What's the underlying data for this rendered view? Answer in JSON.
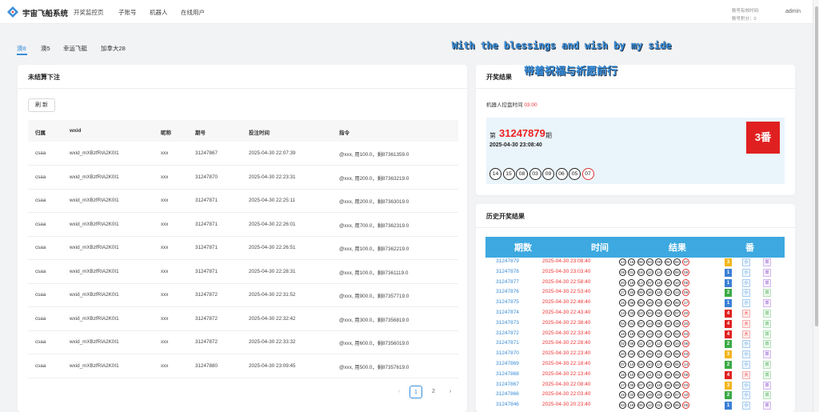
{
  "header": {
    "brand": "宇宙飞船系统",
    "nav": [
      "开奖监控页",
      "子账号",
      "机器人",
      "在线用户"
    ],
    "account_expiry_label": "账号有效时间:",
    "account_points_label": "账号积分：0",
    "user": "admin"
  },
  "tabs": [
    "澳8",
    "澳5",
    "幸运飞艇",
    "加拿大28"
  ],
  "banner": {
    "english": "With the blessings and wish by my side",
    "chinese": "带着祝福与祈愿前行"
  },
  "pending": {
    "title": "未结算下注",
    "refresh_label": "刷 新",
    "columns": [
      "归属",
      "wxid",
      "昵称",
      "期号",
      "投注时间",
      "指令"
    ],
    "rows": [
      [
        "csaa",
        "wxid_mXBzfRIA2K0I1",
        "xxx",
        "31247867",
        "2025-04-30 22:07:39",
        "@xxx, 用100.0，剩87361359.0"
      ],
      [
        "csaa",
        "wxid_mXBzfRIA2K0I1",
        "xxx",
        "31247870",
        "2025-04-30 22:23:31",
        "@xxx, 用200.0，剩87363219.0"
      ],
      [
        "csaa",
        "wxid_mXBzfRIA2K0I1",
        "xxx",
        "31247871",
        "2025-04-30 22:25:11",
        "@xxx, 用200.0，剩87363019.0"
      ],
      [
        "csaa",
        "wxid_mXBzfRIA2K0I1",
        "xxx",
        "31247871",
        "2025-04-30 22:26:01",
        "@xxx, 用700.0，剩87362319.0"
      ],
      [
        "csaa",
        "wxid_mXBzfRIA2K0I1",
        "xxx",
        "31247871",
        "2025-04-30 22:26:51",
        "@xxx, 用100.0，剩87362219.0"
      ],
      [
        "csaa",
        "wxid_mXBzfRIA2K0I1",
        "xxx",
        "31247871",
        "2025-04-30 22:28:31",
        "@xxx, 用100.0，剩87361119.0"
      ],
      [
        "csaa",
        "wxid_mXBzfRIA2K0I1",
        "xxx",
        "31247872",
        "2025-04-30 22:31:52",
        "@xxx, 用900.0，剩87357719.0"
      ],
      [
        "csaa",
        "wxid_mXBzfRIA2K0I1",
        "xxx",
        "31247872",
        "2025-04-30 22:32:42",
        "@xxx, 用300.0，剩87356819.0"
      ],
      [
        "csaa",
        "wxid_mXBzfRIA2K0I1",
        "xxx",
        "31247872",
        "2025-04-30 22:33:32",
        "@xxx, 用600.0，剩87356019.0"
      ],
      [
        "csaa",
        "wxid_mXBzfRIA2K0I1",
        "xxx",
        "31247880",
        "2025-04-30 23:09:45",
        "@xxx, 用500.0，剩87357619.0"
      ]
    ],
    "pages": [
      "1",
      "2"
    ]
  },
  "result": {
    "title": "开奖结果",
    "robot_label": "机器人控盘时间",
    "robot_time": "03:00",
    "issue_prefix": "第",
    "issue": "31247879",
    "issue_suffix": "期",
    "time": "2025-04-30 23:08:40",
    "fan": "3番",
    "balls": [
      "14",
      "15",
      "08",
      "03",
      "09",
      "06",
      "05",
      "07"
    ]
  },
  "history": {
    "title": "历史开奖结果",
    "columns": [
      "期数",
      "时间",
      "结果",
      "番"
    ],
    "rows": [
      {
        "issue": "31247879",
        "time": "2025-04-30 23:08:40",
        "balls": [
          "14",
          "15",
          "08",
          "03",
          "09",
          "06",
          "05",
          "07"
        ],
        "fan": "3",
        "size": "小",
        "parity": "单"
      },
      {
        "issue": "31247878",
        "time": "2025-04-30 23:03:40",
        "balls": [
          "09",
          "01",
          "18",
          "12",
          "14",
          "15",
          "08",
          "05"
        ],
        "fan": "1",
        "size": "小",
        "parity": "单"
      },
      {
        "issue": "31247877",
        "time": "2025-04-30 22:58:40",
        "balls": [
          "20",
          "19",
          "13",
          "07",
          "16",
          "08",
          "10",
          "05"
        ],
        "fan": "1",
        "size": "小",
        "parity": "单"
      },
      {
        "issue": "31247876",
        "time": "2025-04-30 22:53:40",
        "balls": [
          "17",
          "20",
          "09",
          "18",
          "16",
          "12",
          "13",
          "06"
        ],
        "fan": "2",
        "size": "小",
        "parity": "双"
      },
      {
        "issue": "31247875",
        "time": "2025-04-30 22:48:40",
        "balls": [
          "15",
          "06",
          "09",
          "16",
          "03",
          "02",
          "08",
          "17"
        ],
        "fan": "1",
        "size": "小",
        "parity": "单"
      },
      {
        "issue": "31247874",
        "time": "2025-04-30 22:43:40",
        "balls": [
          "13",
          "03",
          "10",
          "04",
          "06",
          "12",
          "07",
          "20"
        ],
        "fan": "4",
        "size": "大",
        "parity": "双"
      },
      {
        "issue": "31247873",
        "time": "2025-04-30 22:38:40",
        "balls": [
          "04",
          "01",
          "07",
          "14",
          "08",
          "16",
          "19",
          "20"
        ],
        "fan": "4",
        "size": "大",
        "parity": "双"
      },
      {
        "issue": "31247872",
        "time": "2025-04-30 22:33:40",
        "balls": [
          "16",
          "19",
          "10",
          "14",
          "13",
          "12",
          "02",
          "04"
        ],
        "fan": "4",
        "size": "大",
        "parity": "双"
      },
      {
        "issue": "31247871",
        "time": "2025-04-30 22:28:40",
        "balls": [
          "02",
          "05",
          "11",
          "17",
          "12",
          "03",
          "10",
          "06"
        ],
        "fan": "2",
        "size": "小",
        "parity": "双"
      },
      {
        "issue": "31247870",
        "time": "2025-04-30 22:23:40",
        "balls": [
          "20",
          "04",
          "17",
          "05",
          "10",
          "13",
          "06",
          "03"
        ],
        "fan": "3",
        "size": "小",
        "parity": "单"
      },
      {
        "issue": "31247869",
        "time": "2025-04-30 22:18:40",
        "balls": [
          "07",
          "13",
          "18",
          "10",
          "17",
          "03",
          "05",
          "14"
        ],
        "fan": "2",
        "size": "小",
        "parity": "双"
      },
      {
        "issue": "31247868",
        "time": "2025-04-30 22:13:40",
        "balls": [
          "18",
          "10",
          "07",
          "11",
          "01",
          "04",
          "09",
          "08"
        ],
        "fan": "4",
        "size": "大",
        "parity": "双"
      },
      {
        "issue": "31247867",
        "time": "2025-04-30 22:08:40",
        "balls": [
          "17",
          "05",
          "07",
          "10",
          "16",
          "06",
          "09",
          "03"
        ],
        "fan": "3",
        "size": "小",
        "parity": "单"
      },
      {
        "issue": "31247866",
        "time": "2025-04-30 22:03:40",
        "balls": [
          "15",
          "02",
          "09",
          "19",
          "20",
          "16",
          "07",
          "10"
        ],
        "fan": "2",
        "size": "小",
        "parity": "双"
      },
      {
        "issue": "31247846",
        "time": "2025-04-30 20:23:40",
        "balls": [
          "04",
          "16",
          "06",
          "12",
          "01",
          "02",
          "09",
          "05"
        ],
        "fan": "1",
        "size": "小",
        "parity": "单"
      }
    ]
  },
  "colors": {
    "accent": "#3b8ed8",
    "red": "#e02020",
    "fan1": "#3a7fd5",
    "fan2": "#3aaa45",
    "fan3": "#f2b51c",
    "fan4": "#e02020"
  }
}
